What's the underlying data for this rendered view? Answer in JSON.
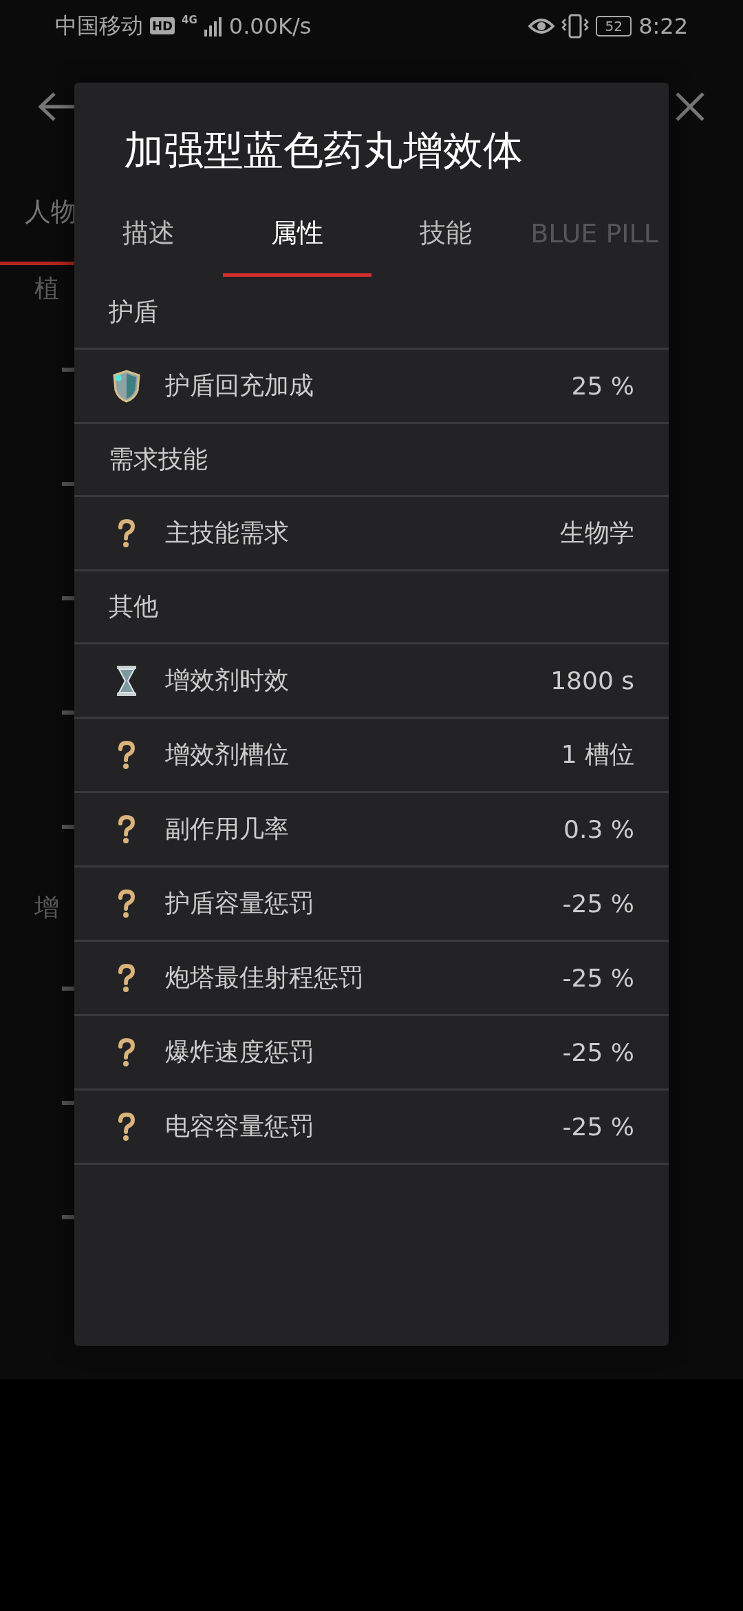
{
  "status_bar": {
    "carrier": "中国移动",
    "hd_badge": "HD",
    "network_type": "4G",
    "network_speed": "0.00K/s",
    "battery": "52",
    "time": "8:22"
  },
  "background": {
    "tab": "人物",
    "sections": [
      "植",
      "增"
    ]
  },
  "dialog": {
    "title": "加强型蓝色药丸增效体",
    "tabs": [
      {
        "label": "描述",
        "selected": false,
        "disabled": false
      },
      {
        "label": "属性",
        "selected": true,
        "disabled": false
      },
      {
        "label": "技能",
        "selected": false,
        "disabled": false
      },
      {
        "label": "BLUE PILL",
        "selected": false,
        "disabled": true
      }
    ],
    "sections": [
      {
        "title": "护盾",
        "rows": [
          {
            "kind": "shield",
            "label": "护盾回充加成",
            "value": "25 %"
          }
        ]
      },
      {
        "title": "需求技能",
        "rows": [
          {
            "kind": "unknown",
            "label": "主技能需求",
            "value": "生物学"
          }
        ]
      },
      {
        "title": "其他",
        "rows": [
          {
            "kind": "hourglass",
            "label": "增效剂时效",
            "value": "1800 s"
          },
          {
            "kind": "unknown",
            "label": "增效剂槽位",
            "value": "1 槽位"
          },
          {
            "kind": "unknown",
            "label": "副作用几率",
            "value": "0.3 %"
          },
          {
            "kind": "unknown",
            "label": "护盾容量惩罚",
            "value": "-25 %"
          },
          {
            "kind": "unknown",
            "label": "炮塔最佳射程惩罚",
            "value": "-25 %"
          },
          {
            "kind": "unknown",
            "label": "爆炸速度惩罚",
            "value": "-25 %"
          },
          {
            "kind": "unknown",
            "label": "电容容量惩罚",
            "value": "-25 %"
          }
        ]
      }
    ]
  }
}
